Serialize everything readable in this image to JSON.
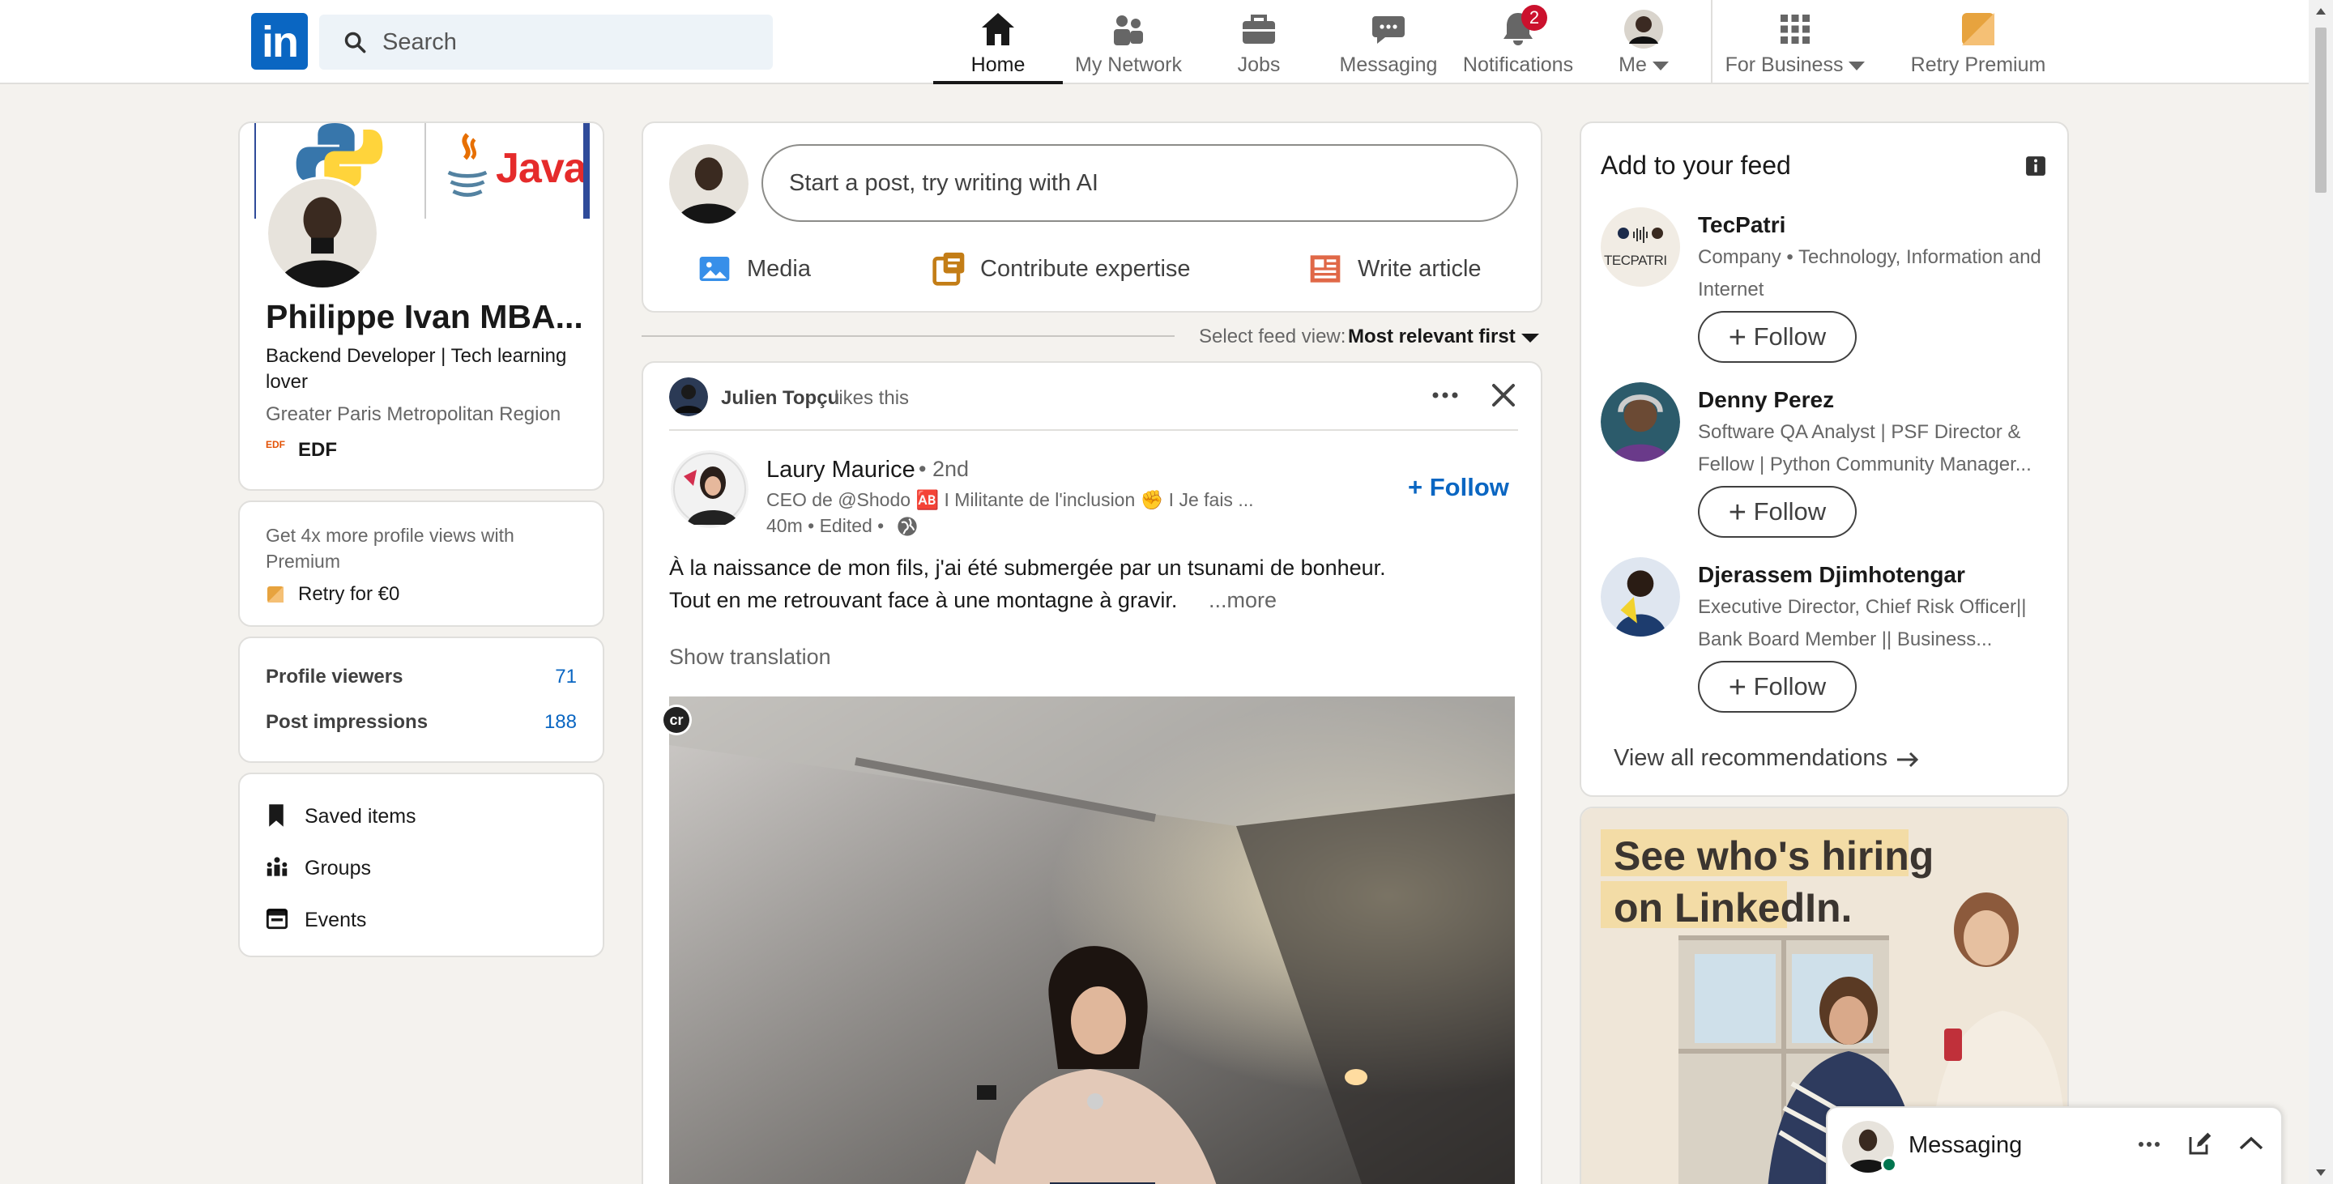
{
  "header": {
    "logo_text": "in",
    "search_placeholder": "Search",
    "nav": [
      {
        "label": "Home",
        "icon": "home-icon"
      },
      {
        "label": "My Network",
        "icon": "people-icon"
      },
      {
        "label": "Jobs",
        "icon": "briefcase-icon"
      },
      {
        "label": "Messaging",
        "icon": "chat-icon"
      },
      {
        "label": "Notifications",
        "icon": "bell-icon",
        "badge": "2"
      },
      {
        "label": "Me",
        "icon": "avatar"
      },
      {
        "label": "For Business",
        "icon": "grid-icon"
      },
      {
        "label": "Retry Premium",
        "icon": "premium-icon"
      }
    ],
    "active_index": 0
  },
  "profile": {
    "banner_java": "Java",
    "name": "Philippe Ivan MBA...",
    "headline_line1": "Backend Developer | Tech learning",
    "headline_line2": "lover",
    "location": "Greater Paris Metropolitan Region",
    "company_logo_text": "EDF",
    "company": "EDF"
  },
  "premium_card": {
    "line1": "Get 4x more profile views with",
    "line2": "Premium",
    "cta": "Retry for €0"
  },
  "stats": [
    {
      "label": "Profile viewers",
      "value": "71"
    },
    {
      "label": "Post impressions",
      "value": "188"
    }
  ],
  "shortcuts": [
    {
      "label": "Saved items",
      "icon": "bookmark-icon"
    },
    {
      "label": "Groups",
      "icon": "groups-icon"
    },
    {
      "label": "Events",
      "icon": "calendar-icon"
    }
  ],
  "composer": {
    "placeholder": "Start a post, try writing with AI",
    "actions": [
      {
        "label": "Media",
        "icon": "image-icon",
        "color": "#378fe9"
      },
      {
        "label": "Contribute expertise",
        "icon": "expertise-icon",
        "color": "#c37d16"
      },
      {
        "label": "Write article",
        "icon": "article-icon",
        "color": "#e06847"
      }
    ]
  },
  "feed_view": {
    "label": "Select feed view:",
    "value": "Most relevant first"
  },
  "post": {
    "liker_name": "Julien Topçu",
    "liker_suffix": "likes this",
    "author": "Laury Maurice",
    "degree": "• 2nd",
    "subtitle": "CEO de @Shodo 🆎 I Militante de l'inclusion ✊ I Je fais ...",
    "meta": "40m • Edited •",
    "follow": "+ Follow",
    "text_line1": "À la naissance de mon fils, j'ai été submergée par un tsunami de bonheur.",
    "text_line2": "Tout en me retrouvant face à une montagne à gravir.",
    "more": "...more",
    "translation": "Show translation",
    "cr_badge": "cr"
  },
  "feed_suggestions": {
    "title": "Add to your feed",
    "items": [
      {
        "name": "TecPatri",
        "desc1": "Company • Technology, Information and",
        "desc2": "Internet",
        "logo_text": "TECPATRI",
        "follow": "Follow"
      },
      {
        "name": "Denny Perez",
        "desc1": "Software QA Analyst | PSF Director &",
        "desc2": "Fellow | Python Community Manager...",
        "follow": "Follow"
      },
      {
        "name": "Djerassem Djimhotengar",
        "desc1": "Executive Director, Chief Risk Officer||",
        "desc2": "Bank Board Member || Business...",
        "follow": "Follow"
      }
    ],
    "view_all": "View all recommendations"
  },
  "ad": {
    "line1": "See who's hiring",
    "line2": "on LinkedIn."
  },
  "messaging": {
    "label": "Messaging"
  },
  "colors": {
    "brand": "#0a66c2",
    "background": "#f4f2ee",
    "badge": "#cb112d"
  }
}
